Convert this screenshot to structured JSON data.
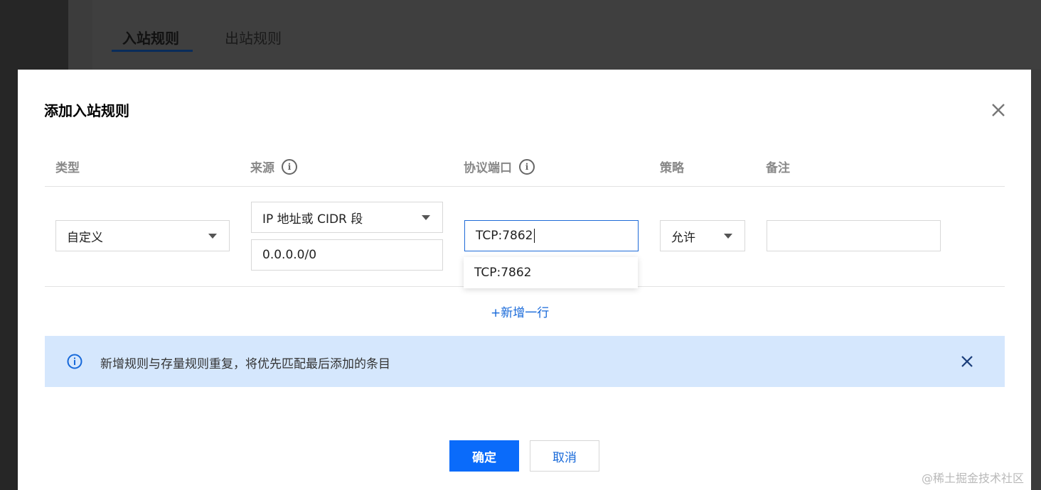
{
  "background": {
    "tabs": [
      {
        "label": "入站规则",
        "active": true
      },
      {
        "label": "出站规则",
        "active": false
      }
    ]
  },
  "modal": {
    "title": "添加入站规则",
    "columns": {
      "type": "类型",
      "source": "来源",
      "protocol_port": "协议端口",
      "policy": "策略",
      "remark": "备注"
    },
    "row": {
      "type_value": "自定义",
      "source_type": "IP 地址或 CIDR 段",
      "source_value": "0.0.0.0/0",
      "protocol_port_value": "TCP:7862",
      "policy_value": "允许",
      "remark_value": ""
    },
    "suggestion": "TCP:7862",
    "add_row_label": "+新增一行",
    "notice": "新增规则与存量规则重复，将优先匹配最后添加的条目",
    "confirm_label": "确定",
    "cancel_label": "取消"
  },
  "watermark": "@稀土掘金技术社区",
  "colors": {
    "primary": "#0a6bfa",
    "link": "#1668d9",
    "notice_bg": "#d5e7fd",
    "focus_border": "#1e6bd8"
  },
  "icons": {
    "close": "close-icon",
    "info": "info-circle-icon",
    "dropdown": "chevron-down-icon"
  }
}
